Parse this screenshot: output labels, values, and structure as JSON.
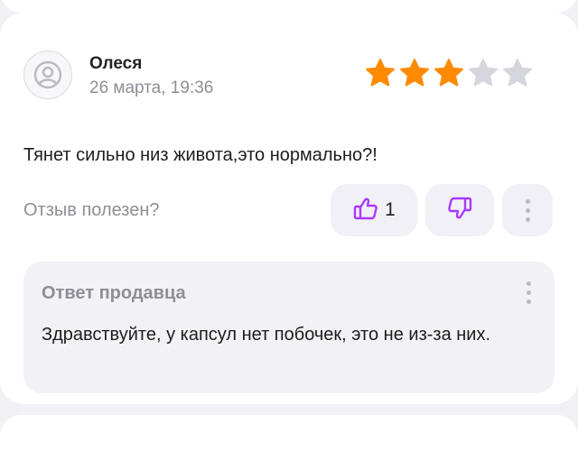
{
  "review": {
    "author": "Олеся",
    "date": "26 марта, 19:36",
    "rating": 3,
    "rating_max": 5,
    "text": "Тянет сильно низ живота,это нормально?!",
    "helpful_label": "Отзыв полезен?",
    "like_count": "1"
  },
  "seller_reply": {
    "title": "Ответ продавца",
    "text": "Здравствуйте, у капсул нет побочек, это не из-за них."
  },
  "colors": {
    "star_filled": "#ff8a00",
    "star_empty": "#d6d6de",
    "accent": "#a73afd",
    "muted_text": "#8e8e96"
  },
  "icons": {
    "avatar": "user-avatar-icon",
    "like": "thumbs-up-icon",
    "dislike": "thumbs-down-icon",
    "more": "more-vertical-icon"
  }
}
